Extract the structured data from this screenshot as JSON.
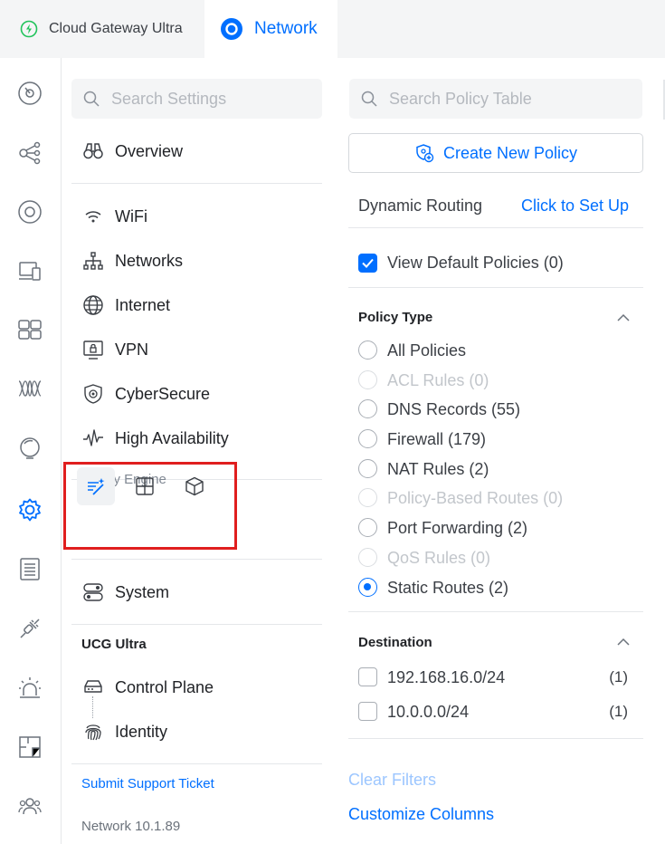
{
  "topbar": {
    "gateway_tab": "Cloud Gateway Ultra",
    "network_tab": "Network",
    "colors": {
      "accent": "#006fff",
      "online": "#21c35b"
    }
  },
  "rail": {
    "icons": [
      "dashboard-icon",
      "topology-icon",
      "devices-icon",
      "client-devices-icon",
      "ports-icon",
      "radio-icon",
      "insights-icon",
      "settings-icon",
      "logs-icon",
      "integrations-icon",
      "alarms-icon",
      "floorplan-icon",
      "users-icon"
    ]
  },
  "settings": {
    "search_placeholder": "Search Settings",
    "overview": "Overview",
    "items": [
      {
        "label": "WiFi",
        "icon": "wifi-icon"
      },
      {
        "label": "Networks",
        "icon": "networks-icon"
      },
      {
        "label": "Internet",
        "icon": "globe-icon"
      },
      {
        "label": "VPN",
        "icon": "vpn-icon"
      },
      {
        "label": "CyberSecure",
        "icon": "shield-icon"
      },
      {
        "label": "High Availability",
        "icon": "pulse-icon"
      }
    ],
    "policy_engine_label": "Policy Engine",
    "system": "System",
    "device_section": "UCG Ultra",
    "control_plane": "Control Plane",
    "identity": "Identity",
    "support_link": "Submit Support Ticket",
    "version": "Network 10.1.89"
  },
  "policy": {
    "search_placeholder": "Search Policy Table",
    "create_button": "Create New Policy",
    "dynamic_routing": "Dynamic Routing",
    "setup_link": "Click to Set Up",
    "view_default": "View Default Policies (0)",
    "view_default_checked": true,
    "policy_type_title": "Policy Type",
    "types": [
      {
        "label": "All Policies",
        "disabled": false,
        "selected": false
      },
      {
        "label": "ACL Rules (0)",
        "disabled": true,
        "selected": false
      },
      {
        "label": "DNS Records (55)",
        "disabled": false,
        "selected": false
      },
      {
        "label": "Firewall (179)",
        "disabled": false,
        "selected": false
      },
      {
        "label": "NAT Rules (2)",
        "disabled": false,
        "selected": false
      },
      {
        "label": "Policy-Based Routes (0)",
        "disabled": true,
        "selected": false
      },
      {
        "label": "Port Forwarding (2)",
        "disabled": false,
        "selected": false
      },
      {
        "label": "QoS Rules (0)",
        "disabled": true,
        "selected": false
      },
      {
        "label": "Static Routes (2)",
        "disabled": false,
        "selected": true
      }
    ],
    "destination_title": "Destination",
    "destinations": [
      {
        "label": "192.168.16.0/24",
        "count": "(1)"
      },
      {
        "label": "10.0.0.0/24",
        "count": "(1)"
      }
    ],
    "clear_filters": "Clear Filters",
    "customize_columns": "Customize Columns"
  }
}
